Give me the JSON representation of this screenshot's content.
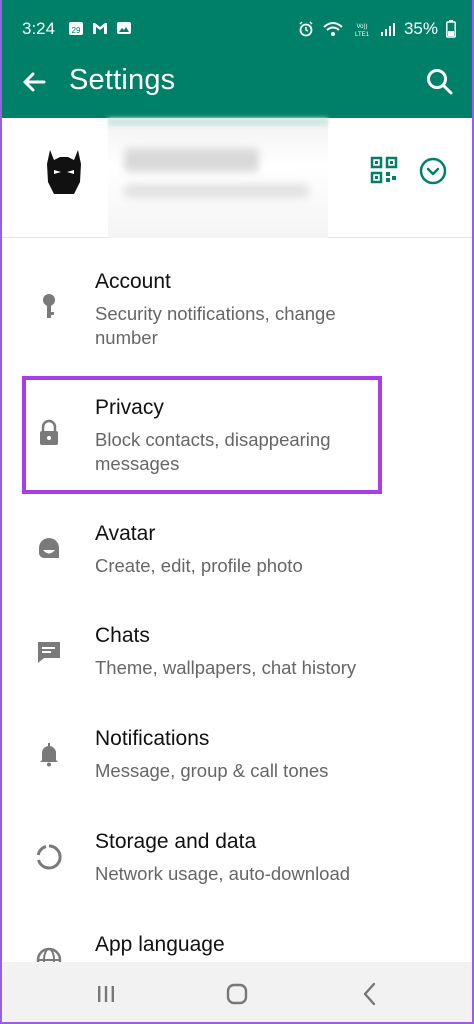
{
  "status_bar": {
    "time": "3:24",
    "battery": "35%",
    "left_icons": [
      "calendar-icon",
      "gmail-icon",
      "gallery-icon"
    ],
    "right_icons": [
      "alarm-icon",
      "wifi-icon",
      "volte-icon",
      "signal-icon"
    ]
  },
  "app_bar": {
    "title": "Settings",
    "back_icon": "arrow-left-icon",
    "search_icon": "search-icon"
  },
  "profile": {
    "avatar": "batman-avatar",
    "name_blurred": true,
    "qr_icon": "qr-code-icon",
    "expand_icon": "chevron-down-circle-icon"
  },
  "colors": {
    "header": "#008069",
    "accent": "#008069",
    "highlight": "#a73ee8",
    "icon_gray": "#7a7a7a"
  },
  "settings": [
    {
      "title": "Account",
      "subtitle": "Security notifications, change number",
      "icon": "key-icon"
    },
    {
      "title": "Privacy",
      "subtitle": "Block contacts, disappearing messages",
      "icon": "lock-icon"
    },
    {
      "title": "Avatar",
      "subtitle": "Create, edit, profile photo",
      "icon": "avatar-face-icon"
    },
    {
      "title": "Chats",
      "subtitle": "Theme, wallpapers, chat history",
      "icon": "chat-icon"
    },
    {
      "title": "Notifications",
      "subtitle": "Message, group & call tones",
      "icon": "bell-icon"
    },
    {
      "title": "Storage and data",
      "subtitle": "Network usage, auto-download",
      "icon": "storage-circle-icon"
    },
    {
      "title": "App language",
      "subtitle": "",
      "icon": "globe-icon"
    }
  ],
  "nav_bar": {
    "recents": "recents-icon",
    "home": "home-icon",
    "back": "back-chevron-icon"
  }
}
